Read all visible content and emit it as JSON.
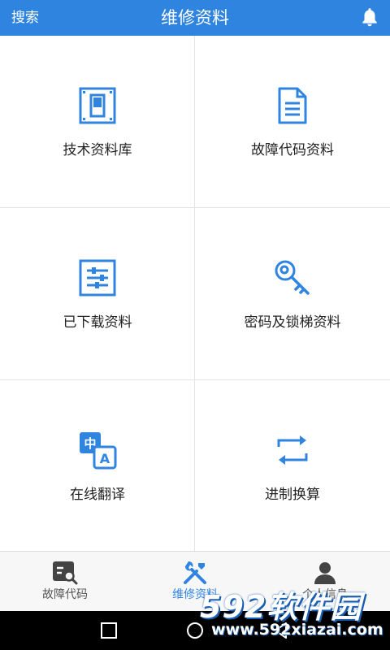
{
  "header": {
    "search_label": "搜索",
    "title": "维修资料",
    "icon": "bell-icon"
  },
  "grid": {
    "items": [
      {
        "label": "技术资料库",
        "icon": "switch-panel-icon"
      },
      {
        "label": "故障代码资料",
        "icon": "document-icon"
      },
      {
        "label": "已下载资料",
        "icon": "sliders-icon"
      },
      {
        "label": "密码及锁梯资料",
        "icon": "key-icon"
      },
      {
        "label": "在线翻译",
        "icon": "translate-icon"
      },
      {
        "label": "进制换算",
        "icon": "convert-arrows-icon"
      }
    ]
  },
  "tabs": [
    {
      "label": "故障代码",
      "icon": "fault-code-search-icon",
      "active": false
    },
    {
      "label": "维修资料",
      "icon": "tools-icon",
      "active": true
    },
    {
      "label": "个人信息",
      "icon": "person-icon",
      "active": false
    }
  ],
  "watermark": {
    "brand": "592软件园",
    "url": "www.592xiazai.com"
  },
  "colors": {
    "accent": "#2f84e0",
    "tab_inactive": "#555555",
    "navbar": "#000000"
  }
}
